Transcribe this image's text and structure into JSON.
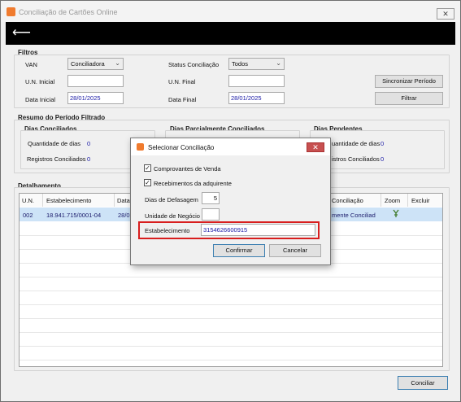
{
  "window": {
    "title": "Conciliação de Cartões Online",
    "close_glyph": "✕"
  },
  "toolbar": {
    "back_glyph": "⟵"
  },
  "filtros": {
    "title": "Filtros",
    "van_label": "VAN",
    "van_value": "Conciliadora",
    "un_inicial_label": "U.N. Inicial",
    "un_inicial_value": "",
    "data_inicial_label": "Data Inicial",
    "data_inicial_value": "28/01/2025",
    "status_label": "Status Conciliação",
    "status_value": "Todos",
    "un_final_label": "U.N. Final",
    "un_final_value": "",
    "data_final_label": "Data Final",
    "data_final_value": "28/01/2025",
    "sync_button": "Sincronizar Período",
    "filter_button": "Filtrar"
  },
  "resumo": {
    "title": "Resumo do Período Filtrado",
    "conciliados": {
      "title": "Dias Conciliados",
      "qtd_label": "Quantidade de dias",
      "qtd_value": "0",
      "reg_label": "Registros Conciliados",
      "reg_value": "0"
    },
    "parciais": {
      "title": "Dias Parcialmente Conciliados"
    },
    "pendentes": {
      "title": "Dias Pendentes",
      "qtd_label": "uantidade de dias",
      "qtd_value": "0",
      "reg_label": "istros Conciliados",
      "reg_value": "0"
    }
  },
  "detalhamento": {
    "title": "Detalhamento",
    "columns": [
      "U.N.",
      "Estabelecimento",
      "Data",
      "Conciliação",
      "Zoom",
      "Excluir"
    ],
    "rows": [
      {
        "un": "002",
        "estabelecimento": "18.941.715/0001-04",
        "data": "28/0",
        "conciliacao": "mente Conciliad",
        "zoom_icon": "zoom-icon"
      }
    ]
  },
  "footer": {
    "conciliar_button": "Conciliar"
  },
  "dialog": {
    "title": "Selecionar Conciliação",
    "close_glyph": "✕",
    "chk_comprovantes_label": "Comprovantes de Venda",
    "chk_comprovantes_checked": true,
    "chk_recebimentos_label": "Recebimentos da adquirente",
    "chk_recebimentos_checked": true,
    "dias_label": "Dias de Defasagem",
    "dias_value": "5",
    "unidade_label": "Unidade de Negócio",
    "unidade_value": "",
    "estab_label": "Estabelecimento",
    "estab_value": "3154626600915",
    "confirm_button": "Confirmar",
    "cancel_button": "Cancelar",
    "check_glyph": "✓"
  },
  "colors": {
    "highlight": "#d81e1e",
    "value_text": "#1a1aa6",
    "selected_row": "#cde3f7"
  }
}
